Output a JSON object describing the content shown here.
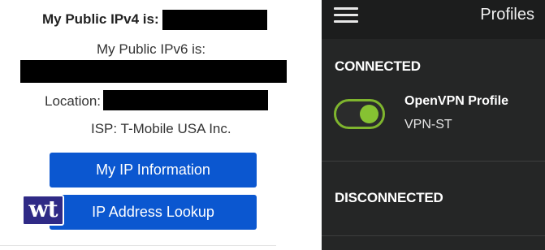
{
  "ip_page": {
    "ipv4_label": "My Public IPv4 is:",
    "ipv6_label": "My Public IPv6 is:",
    "location_label": "Location:",
    "isp_text": "ISP: T-Mobile USA Inc.",
    "buttons": {
      "my_ip": "My IP Information",
      "lookup": "IP Address Lookup"
    },
    "logo_text": "wt",
    "colors": {
      "button": "#0b57d0",
      "logo": "#2f2a86"
    }
  },
  "vpn_app": {
    "title": "Profiles",
    "connected_header": "CONNECTED",
    "disconnected_header": "DISCONNECTED",
    "profile": {
      "name": "OpenVPN Profile",
      "server": "VPN-ST",
      "enabled": true
    },
    "colors": {
      "toggle_on": "#86c232",
      "background": "#252626"
    }
  }
}
